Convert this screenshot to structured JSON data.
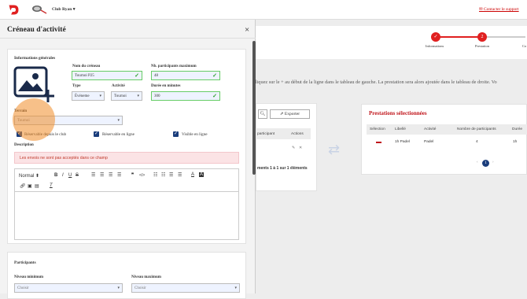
{
  "header": {
    "club_name": "Club Ryan",
    "support_link": "Contacter le support"
  },
  "steps": [
    {
      "num": "✓",
      "label": "Informations"
    },
    {
      "num": "2",
      "label": "Prestation"
    },
    {
      "num": "",
      "label": "Co"
    }
  ],
  "instructions": "cliquez sur le + au début de la ligne dans le tableau de gauche. La prestation sera alors ajoutée dans le tableau de droite. Vo",
  "modal": {
    "title": "Créneau d'activité",
    "close": "×",
    "general_section": "Informations générales",
    "name_label": "Nom du créneau",
    "name_value": "Tournoi P25",
    "max_label": "Nb. participants maximum",
    "max_value": "48",
    "type_label": "Type",
    "type_value": "Événeme",
    "activity_label": "Activité",
    "activity_value": "Tournoi",
    "duration_label": "Durée en minutes",
    "duration_value": "300",
    "terrain_label": "Terrain",
    "terrain_value": "Tournoi",
    "reserve_label": "Réservable depuis le club",
    "online_label": "Réservable en ligne",
    "visible_label": "Visible en ligne",
    "description_label": "Description",
    "alert_text": "Les envois ne sont pas acceptés dans ce champ",
    "editor_style": "Normal",
    "participants_section": "Participants",
    "min_level_label": "Niveau minimum",
    "min_level_value": "Choisir",
    "max_level_label": "Niveau maximum",
    "max_level_value": "Choisir"
  },
  "left_table": {
    "export_label": "Exporter",
    "col_participant": "participant",
    "col_actions": "Actions",
    "footer": "ments 1 à 1 sur 1 éléments"
  },
  "selected": {
    "title": "Prestations sélectionnées",
    "columns": [
      "Sélection",
      "Libellé",
      "Activité",
      "Nombre de participants",
      "Durée"
    ],
    "row": {
      "label": "1h Padel",
      "activity": "Padel",
      "participants": "4",
      "duration": "1h"
    },
    "page": "1"
  }
}
